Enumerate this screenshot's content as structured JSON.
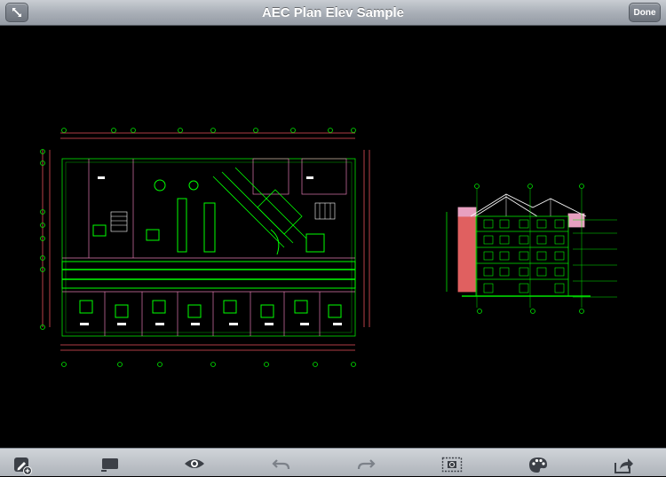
{
  "window": {
    "title": "AEC Plan Elev Sample"
  },
  "navbar": {
    "done_label": "Done",
    "expand_icon": "expand-arrows-icon"
  },
  "toolbar": {
    "items": [
      {
        "name": "markup-add-tool",
        "icon": "pencil-plus-icon"
      },
      {
        "name": "layout-tool",
        "icon": "monitor-icon"
      },
      {
        "name": "view-tool",
        "icon": "eye-icon"
      },
      {
        "name": "undo-tool",
        "icon": "undo-icon"
      },
      {
        "name": "redo-tool",
        "icon": "redo-icon"
      },
      {
        "name": "zoom-window-tool",
        "icon": "zoom-window-icon"
      },
      {
        "name": "color-tool",
        "icon": "palette-icon"
      },
      {
        "name": "share-tool",
        "icon": "share-icon"
      }
    ]
  },
  "colors": {
    "drawing_green": "#00e600",
    "drawing_pink": "#e07ab0",
    "accent_red": "#e8505a",
    "background": "#000000"
  }
}
